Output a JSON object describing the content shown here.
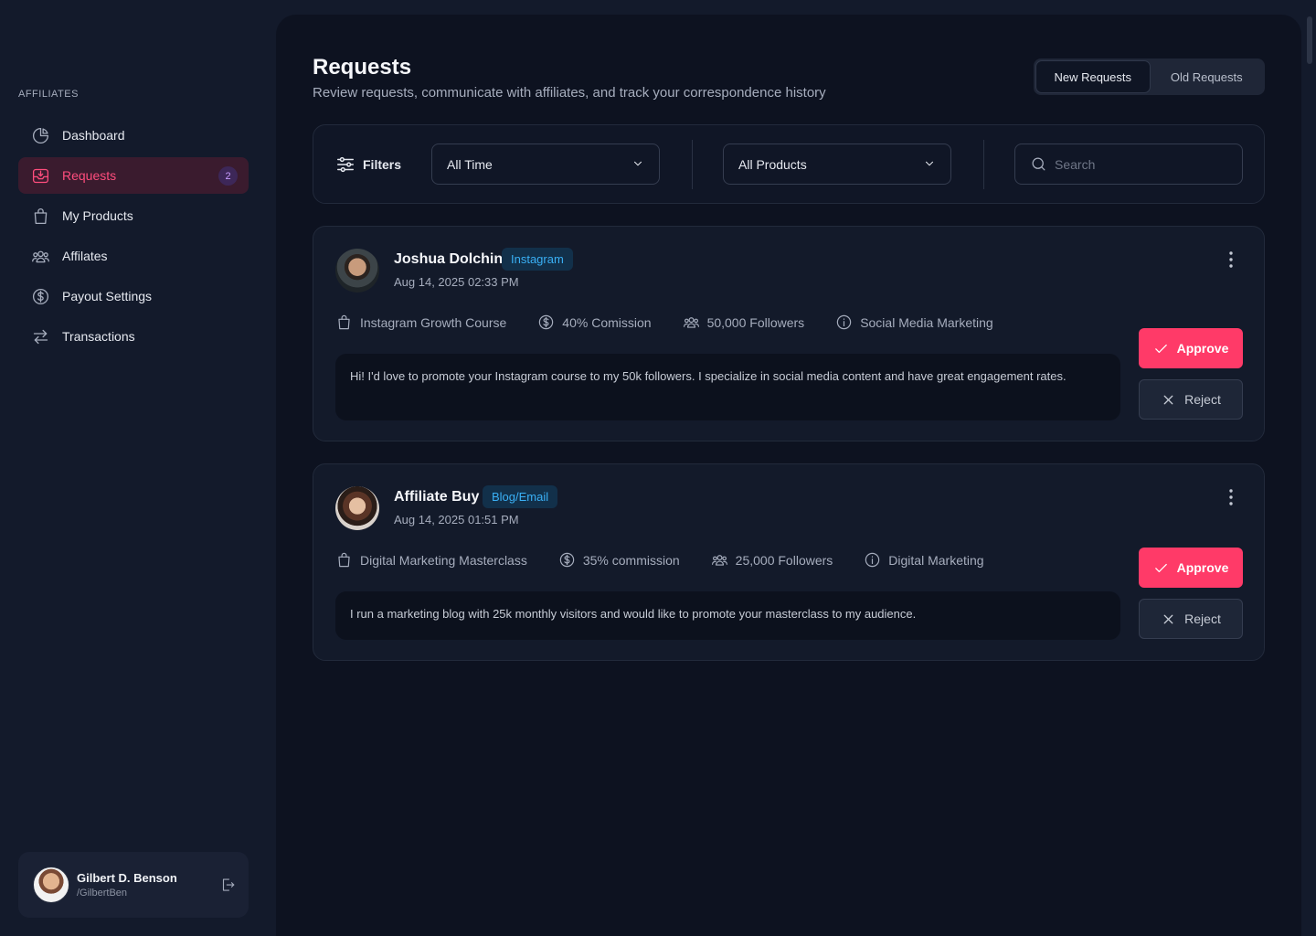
{
  "sidebar": {
    "section_label": "AFFILIATES",
    "items": [
      {
        "label": "Dashboard",
        "icon": "pie-chart-icon"
      },
      {
        "label": "Requests",
        "icon": "inbox-icon",
        "badge": "2",
        "active": true
      },
      {
        "label": "My Products",
        "icon": "shopping-bag-icon"
      },
      {
        "label": "Affilates",
        "icon": "users-icon"
      },
      {
        "label": "Payout Settings",
        "icon": "dollar-circle-icon"
      },
      {
        "label": "Transactions",
        "icon": "arrows-swap-icon"
      }
    ],
    "user": {
      "name": "Gilbert D. Benson",
      "handle": "/GilbertBen"
    }
  },
  "header": {
    "title": "Requests",
    "subtitle": "Review requests, communicate with affiliates, and track your correspondence history",
    "tabs": [
      {
        "label": "New Requests",
        "active": true
      },
      {
        "label": "Old Requests",
        "active": false
      }
    ]
  },
  "filters": {
    "label": "Filters",
    "time_value": "All Time",
    "product_value": "All Products",
    "search_placeholder": "Search"
  },
  "requests": [
    {
      "name": "Joshua Dolchin",
      "channel": "Instagram",
      "date": "Aug 14, 2025 02:33 PM",
      "product": "Instagram Growth Course",
      "commission": "40% Comission",
      "followers": "50,000 Followers",
      "category": "Social Media Marketing",
      "message": "Hi! I'd love to promote your Instagram course to my 50k followers. I specialize in social media content and have great engagement rates.",
      "approve_label": "Approve",
      "reject_label": "Reject"
    },
    {
      "name": "Affiliate Buy",
      "channel": "Blog/Email",
      "date": "Aug 14, 2025 01:51 PM",
      "product": "Digital Marketing Masterclass",
      "commission": "35% commission",
      "followers": "25,000 Followers",
      "category": "Digital Marketing",
      "message": "I run a marketing blog with 25k monthly visitors and would like to promote your masterclass to my audience.",
      "approve_label": "Approve",
      "reject_label": "Reject"
    }
  ],
  "colors": {
    "accent": "#ff3a68",
    "tag_text": "#3ab0f5",
    "background": "#0d1220",
    "sidebar": "#131a2b"
  }
}
